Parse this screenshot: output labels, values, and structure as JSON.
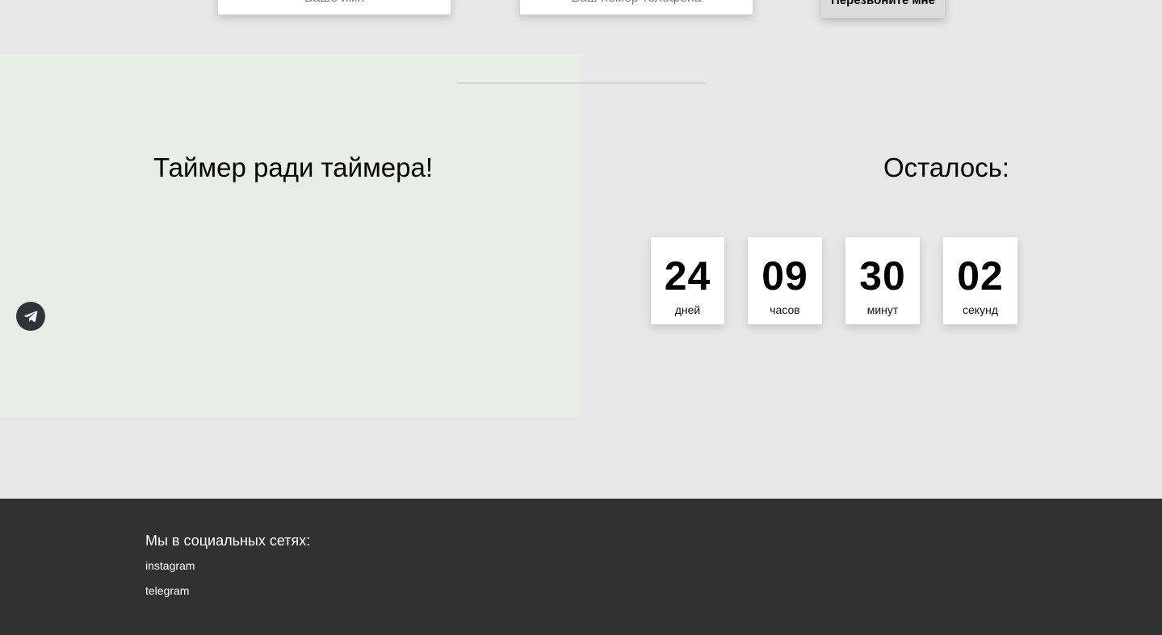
{
  "form": {
    "name_placeholder": "Ваше имя",
    "phone_placeholder": "Ваш номер телефона",
    "submit_label": "Перезвоните мне"
  },
  "promo": {
    "title": "Таймер ради таймера!"
  },
  "timer": {
    "heading": "Осталось:",
    "units": [
      {
        "value": "24",
        "label": "дней"
      },
      {
        "value": "09",
        "label": "часов"
      },
      {
        "value": "30",
        "label": "минут"
      },
      {
        "value": "02",
        "label": "секунд"
      }
    ]
  },
  "floating": {
    "icon": "telegram-icon"
  },
  "footer": {
    "title": "Мы в социальных сетях:",
    "links": [
      "instagram",
      "telegram"
    ]
  },
  "colors": {
    "page_bg": "#e7e7e7",
    "promo_bg": "#e9eee4",
    "footer_bg": "#313131",
    "telegram_bg": "#2f343b"
  }
}
